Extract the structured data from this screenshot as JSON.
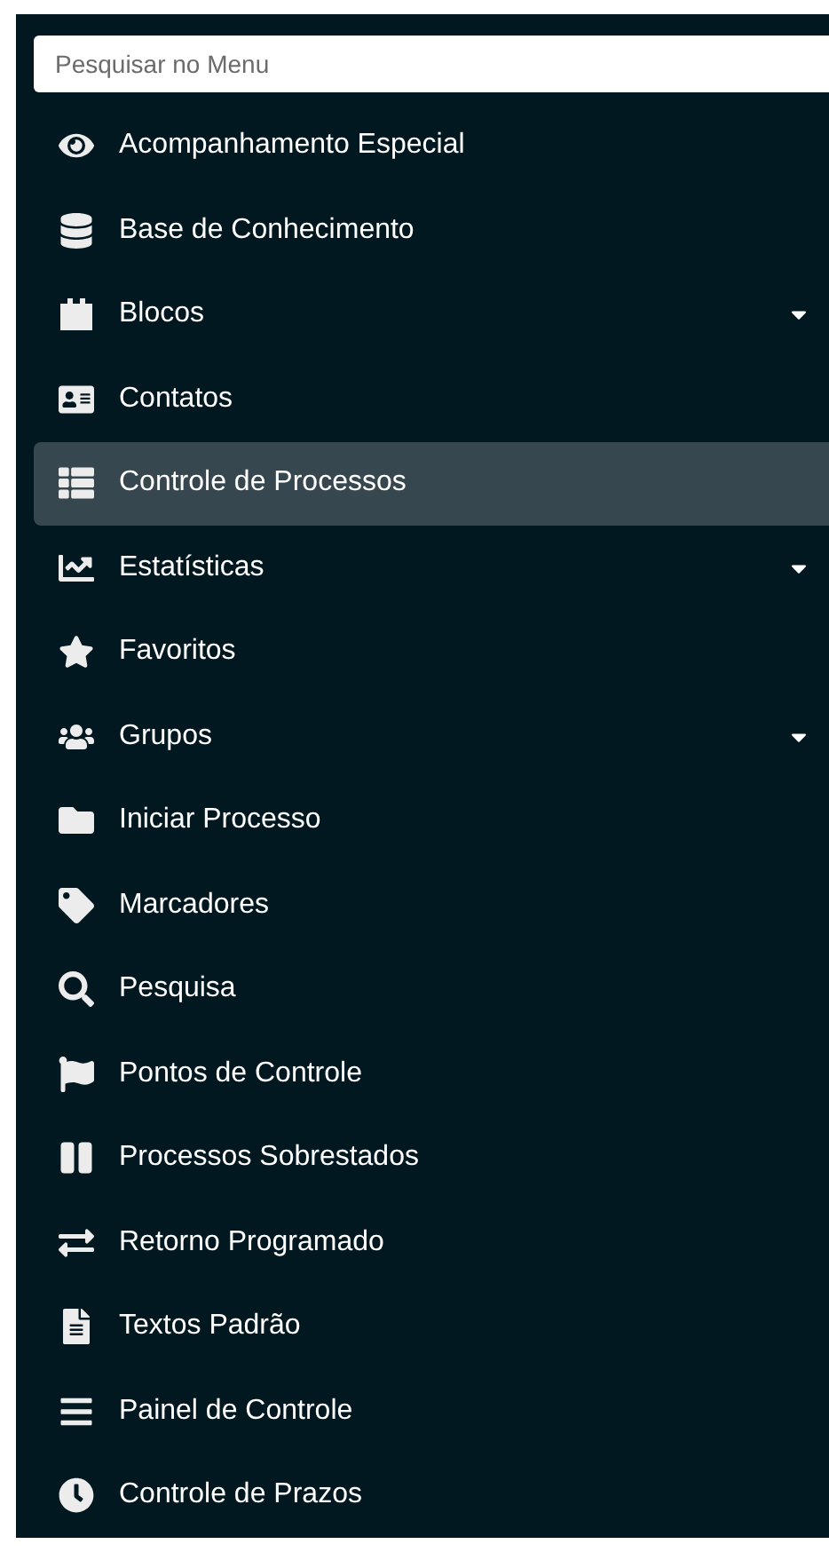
{
  "search": {
    "placeholder": "Pesquisar no Menu"
  },
  "menu": [
    {
      "label": "Acompanhamento Especial",
      "selected": false,
      "has_submenu": false
    },
    {
      "label": "Base de Conhecimento",
      "selected": false,
      "has_submenu": false
    },
    {
      "label": "Blocos",
      "selected": false,
      "has_submenu": true
    },
    {
      "label": "Contatos",
      "selected": false,
      "has_submenu": false
    },
    {
      "label": "Controle de Processos",
      "selected": true,
      "has_submenu": false
    },
    {
      "label": "Estatísticas",
      "selected": false,
      "has_submenu": true
    },
    {
      "label": "Favoritos",
      "selected": false,
      "has_submenu": false
    },
    {
      "label": "Grupos",
      "selected": false,
      "has_submenu": true
    },
    {
      "label": "Iniciar Processo",
      "selected": false,
      "has_submenu": false
    },
    {
      "label": "Marcadores",
      "selected": false,
      "has_submenu": false
    },
    {
      "label": "Pesquisa",
      "selected": false,
      "has_submenu": false
    },
    {
      "label": "Pontos de Controle",
      "selected": false,
      "has_submenu": false
    },
    {
      "label": "Processos Sobrestados",
      "selected": false,
      "has_submenu": false
    },
    {
      "label": "Retorno Programado",
      "selected": false,
      "has_submenu": false
    },
    {
      "label": "Textos Padrão",
      "selected": false,
      "has_submenu": false
    },
    {
      "label": "Painel de Controle",
      "selected": false,
      "has_submenu": false
    },
    {
      "label": "Controle de Prazos",
      "selected": false,
      "has_submenu": false
    }
  ]
}
